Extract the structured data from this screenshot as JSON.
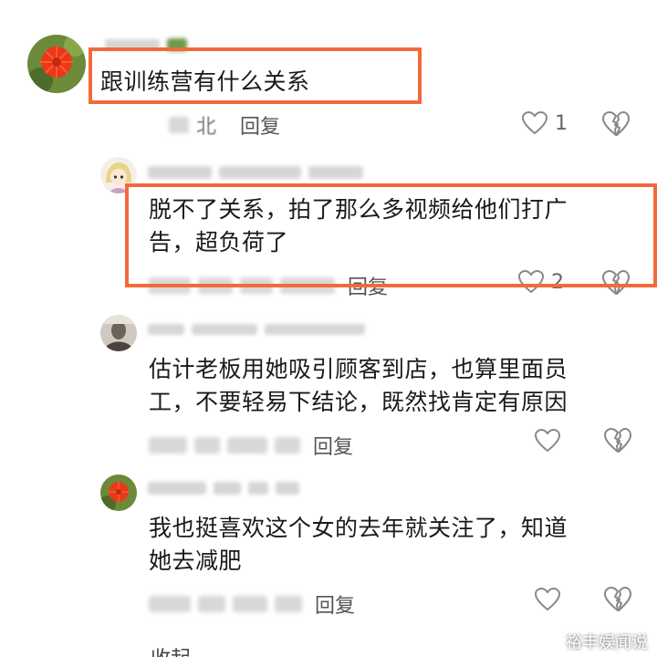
{
  "comments": [
    {
      "text": "跟训练营有什么关系",
      "location": "北",
      "reply_label": "回复",
      "likes": "1"
    },
    {
      "text_line1": "脱不了关系，拍了那么多视频给他们打广",
      "text_line2": "告，超负荷了",
      "reply_label": "回复",
      "likes": "2"
    },
    {
      "text_line1": "估计老板用她吸引顾客到店，也算里面员",
      "text_line2": "工，不要轻易下结论，既然找肯定有原因",
      "reply_label": "回复",
      "likes": ""
    },
    {
      "text_line1": "我也挺喜欢这个女的去年就关注了，知道",
      "text_line2": "她去减肥",
      "reply_label": "回复",
      "likes": ""
    }
  ],
  "collapse_label": "收起",
  "watermark": "裕丰娱闻说",
  "colors": {
    "highlight": "#f26a3b",
    "text": "#1a1a1a",
    "meta": "#555555"
  }
}
